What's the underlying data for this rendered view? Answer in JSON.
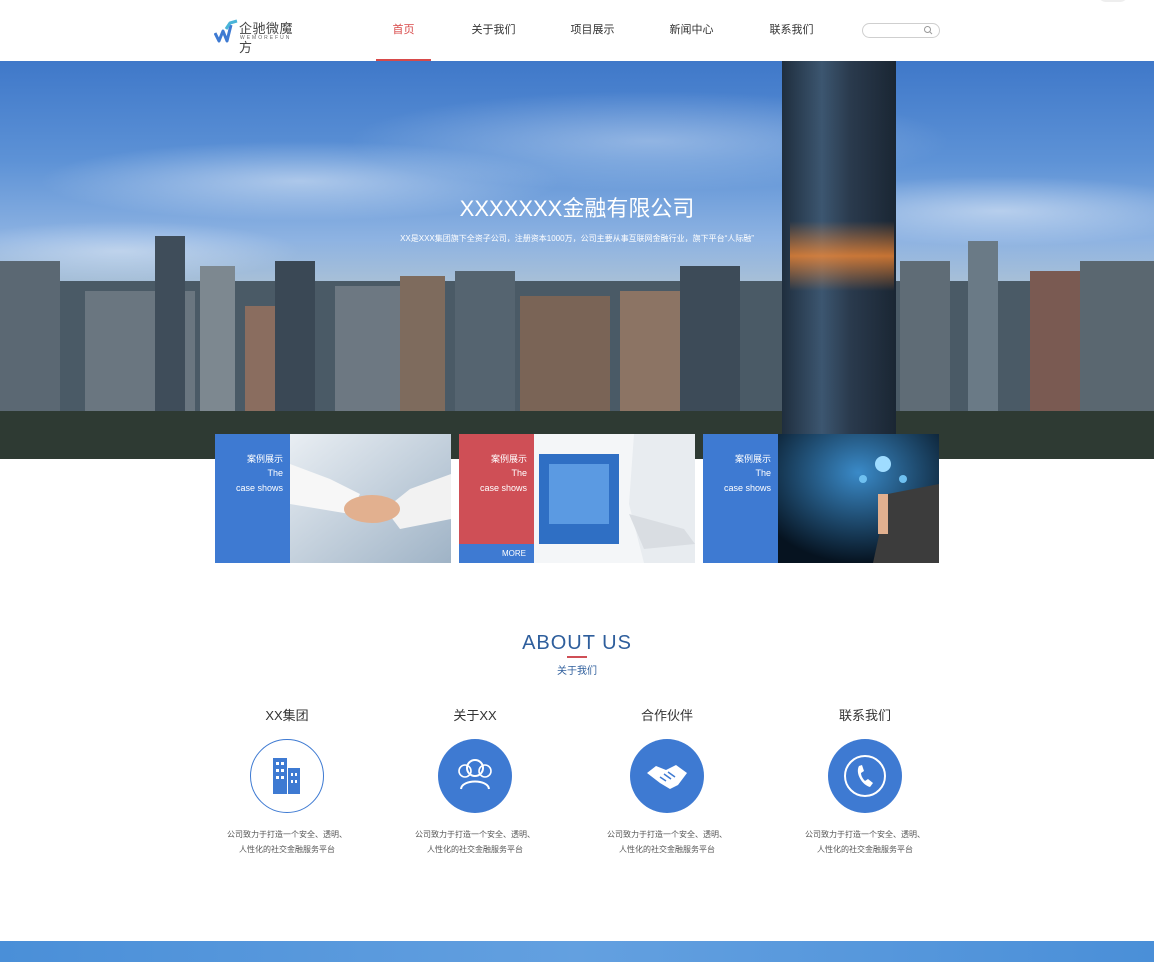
{
  "header": {
    "logo_text": "企驰微魔方",
    "logo_sub": "WEMOREFUN",
    "nav": [
      {
        "label": "首页",
        "active": true
      },
      {
        "label": "关于我们",
        "active": false
      },
      {
        "label": "项目展示",
        "active": false
      },
      {
        "label": "新闻中心",
        "active": false
      },
      {
        "label": "联系我们",
        "active": false
      }
    ],
    "search_placeholder": ""
  },
  "hero": {
    "title": "XXXXXXX金融有限公司",
    "subtitle": "XX是XXX集团旗下全资子公司，注册资本1000万，公司主要从事互联网金融行业，旗下平台“人际融”"
  },
  "cases": [
    {
      "cn": "案例展示",
      "en1": "The",
      "en2": "case shows",
      "highlight": false,
      "more": ""
    },
    {
      "cn": "案例展示",
      "en1": "The",
      "en2": "case shows",
      "highlight": true,
      "more": "MORE"
    },
    {
      "cn": "案例展示",
      "en1": "The",
      "en2": "case shows",
      "highlight": false,
      "more": ""
    }
  ],
  "about": {
    "title": "ABOUT US",
    "subtitle": "关于我们",
    "items": [
      {
        "title": "XX集团",
        "icon": "building-icon",
        "desc1": "公司致力于打造一个安全、透明、",
        "desc2": "人性化的社交金融服务平台"
      },
      {
        "title": "关于XX",
        "icon": "users-icon",
        "desc1": "公司致力于打造一个安全、透明、",
        "desc2": "人性化的社交金融服务平台"
      },
      {
        "title": "合作伙伴",
        "icon": "handshake-icon",
        "desc1": "公司致力于打造一个安全、透明、",
        "desc2": "人性化的社交金融服务平台"
      },
      {
        "title": "联系我们",
        "icon": "phone-icon",
        "desc1": "公司致力于打造一个安全、透明、",
        "desc2": "人性化的社交金融服务平台"
      }
    ]
  },
  "colors": {
    "accent_blue": "#3e7ad2",
    "accent_red": "#cf4f56",
    "nav_active": "#d84a4a",
    "heading_blue": "#2e5e9c"
  }
}
